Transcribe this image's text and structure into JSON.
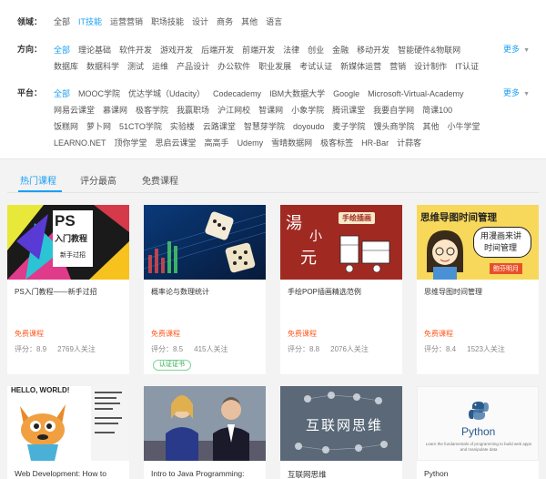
{
  "filters": {
    "domain": {
      "label": "领域：",
      "options": [
        "全部",
        "IT技能",
        "运营营销",
        "职场技能",
        "设计",
        "商务",
        "其他",
        "语言"
      ],
      "active_index": 1
    },
    "direction": {
      "label": "方向：",
      "options": [
        "全部",
        "理论基础",
        "软件开发",
        "游戏开发",
        "后端开发",
        "前端开发",
        "法律",
        "创业",
        "金融",
        "移动开发",
        "智能硬件&物联网",
        "数据库",
        "数据科学",
        "测试",
        "运维",
        "产品设计",
        "办公软件",
        "职业发展",
        "考试认证",
        "新媒体运营",
        "营销",
        "设计制作",
        "IT认证"
      ],
      "active_index": 0,
      "more": "更多"
    },
    "platform": {
      "label": "平台：",
      "options": [
        "全部",
        "MOOC学院",
        "优达学城（Udacity）",
        "Codecademy",
        "IBM大数据大学",
        "Google",
        "Microsoft-Virtual-Academy",
        "网易云课堂",
        "慕课网",
        "极客学院",
        "我赢职场",
        "沪江网校",
        "智课网",
        "小象学院",
        "腾讯课堂",
        "我要自学网",
        "简课100",
        "饭糕网",
        "萝卜网",
        "51CTO学院",
        "实验楼",
        "云路课堂",
        "智慧芽学院",
        "doyoudo",
        "麦子学院",
        "馒头商学院",
        "其他",
        "小牛学堂",
        "LEARNO.NET",
        "顶你学堂",
        "思启云课堂",
        "高高手",
        "Udemy",
        "雪晴数据网",
        "极客标签",
        "HR-Bar",
        "计蒜客"
      ],
      "active_index": 0,
      "more": "更多"
    }
  },
  "tabs": [
    "热门课程",
    "评分最高",
    "免费课程"
  ],
  "active_tab": 0,
  "courses": [
    {
      "title": "PS入门教程——新手过招",
      "price": "免费课程",
      "rating": "评分：8.9",
      "followers": "2769人关注",
      "thumb_text": [
        "PS",
        "入门教程",
        "新手过招"
      ]
    },
    {
      "title": "概率论与数理统计",
      "price": "免费课程",
      "rating": "评分：8.5",
      "followers": "415人关注",
      "badge": "认证证书"
    },
    {
      "title": "手绘POP插画精选范例",
      "price": "免费课程",
      "rating": "评分：8.8",
      "followers": "2076人关注",
      "thumb_text": [
        "湯",
        "小",
        "元",
        "手绘插画"
      ]
    },
    {
      "title": "思维导图时间管理",
      "price": "免费课程",
      "rating": "评分：8.4",
      "followers": "1523人关注",
      "thumb_text": [
        "思维导图时间管理",
        "用漫画来讲",
        "时间管理",
        "鲍芬明月"
      ]
    }
  ],
  "courses_row2": [
    {
      "title": "Web Development: How to",
      "thumb_text": [
        "HELLO, WORLD!"
      ]
    },
    {
      "title": "Intro to Java Programming:"
    },
    {
      "title": "互联网思维",
      "thumb_text": [
        "互联网思维"
      ]
    },
    {
      "title": "Python",
      "thumb_text": [
        "Python",
        "Learn the fundamentals of programming to build web apps and manipulate data"
      ]
    }
  ],
  "colors": {
    "accent": "#1a9ff5",
    "price": "#ff5a1f",
    "badge": "#2aa84a"
  }
}
